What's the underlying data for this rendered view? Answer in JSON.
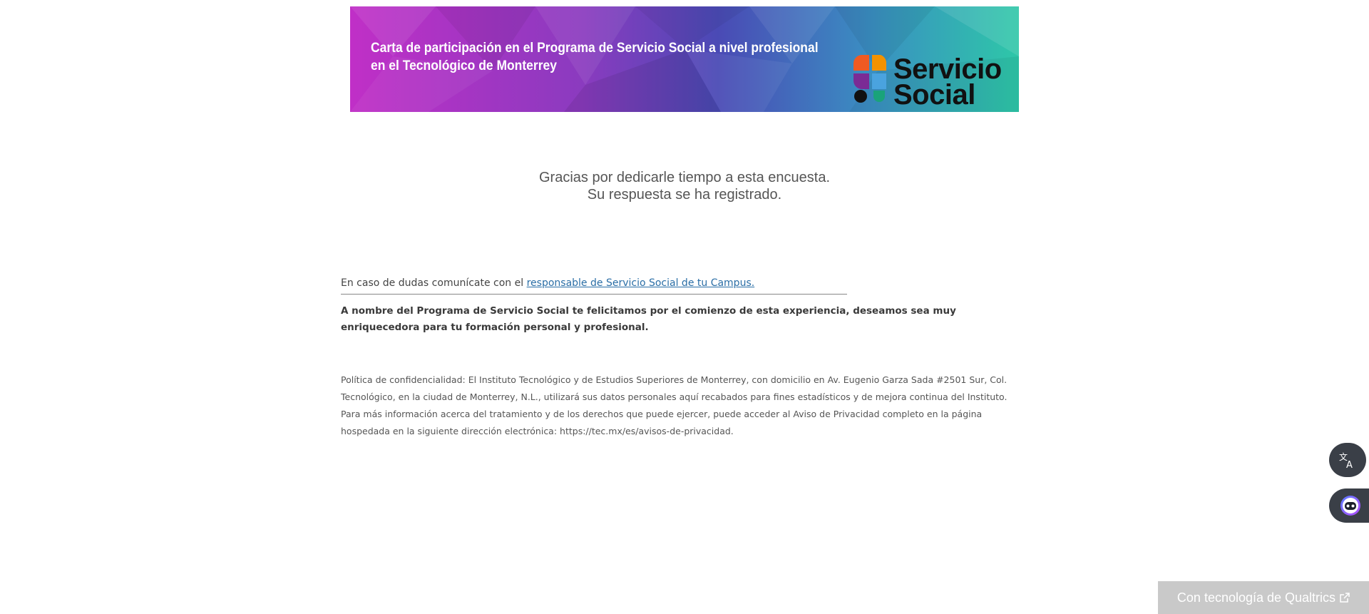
{
  "banner": {
    "title": "Carta de participación en el Programa de Servicio Social a nivel profesional en el Tecnológico de Monterrey",
    "logo_line1": "Servicio",
    "logo_line2": "Social",
    "colors": {
      "gradient_left": "#c02fc7",
      "gradient_mid": "#5a45b8",
      "gradient_right": "#2ec7a8"
    }
  },
  "thanks": {
    "line1": "Gracias por dedicarle tiempo a esta encuesta.",
    "line2": "Su respuesta se ha registrado."
  },
  "contact": {
    "prefix": "En caso de dudas comunícate con el ",
    "link_text": "responsable de Servicio Social de tu Campus."
  },
  "congrats": "A nombre del Programa de Servicio Social te felicitamos por el comienzo de esta experiencia, deseamos sea muy enriquecedora para tu formación personal y profesional.",
  "privacy": "Política de confidencialidad: El Instituto Tecnológico y de Estudios Superiores de Monterrey, con domicilio en Av. Eugenio Garza Sada #2501 Sur, Col. Tecnológico, en la ciudad de Monterrey, N.L., utilizará sus datos personales aquí recabados para fines estadísticos y de mejora continua del Instituto. Para más información acerca del tratamiento y de los derechos que puede ejercer, puede acceder al Aviso de Privacidad completo en la página hospedada en la siguiente dirección electrónica: https://tec.mx/es/avisos-de-privacidad.",
  "floating": {
    "translate_icon": "translate-icon",
    "assistant_icon": "assistant-icon"
  },
  "footer": {
    "powered_by": "Con tecnología de Qualtrics",
    "external_icon": "external-link-icon"
  }
}
